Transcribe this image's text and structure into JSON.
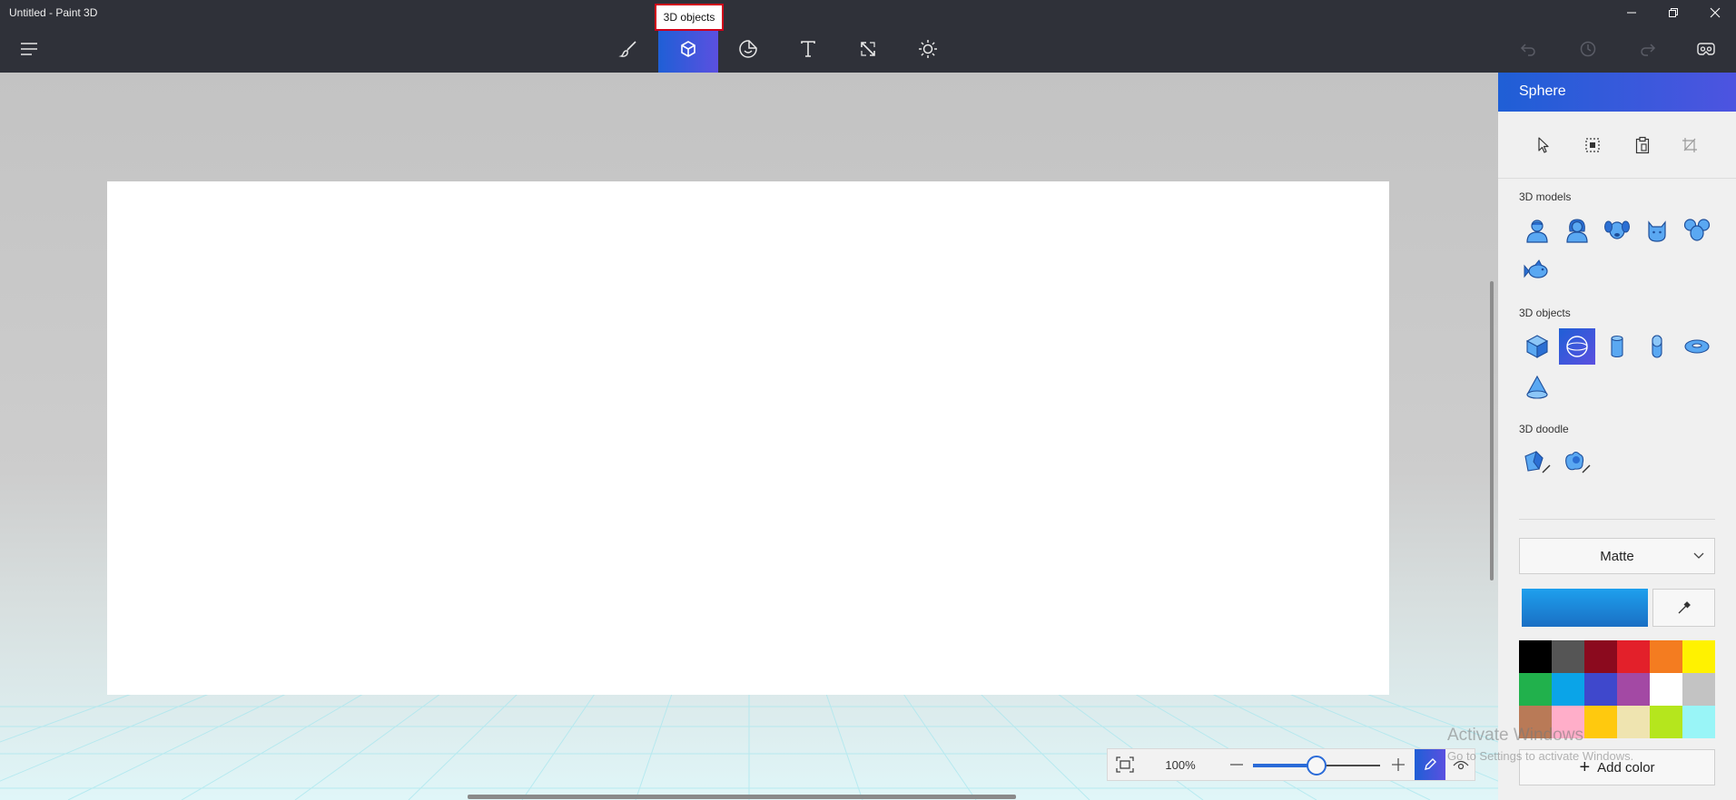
{
  "window": {
    "title": "Untitled - Paint 3D"
  },
  "toolbar": {
    "menu_icon": "hamburger-menu-icon",
    "tools": [
      {
        "name": "Brushes",
        "icon": "brush-icon",
        "active": false
      },
      {
        "name": "3D shapes",
        "icon": "cube-icon",
        "active": true
      },
      {
        "name": "Stickers",
        "icon": "sticker-icon",
        "active": false
      },
      {
        "name": "Text",
        "icon": "text-icon",
        "active": false
      },
      {
        "name": "Canvas",
        "icon": "canvas-resize-icon",
        "active": false
      },
      {
        "name": "Effects",
        "icon": "effects-sun-icon",
        "active": false
      }
    ],
    "tooltip": "3D objects",
    "right": [
      "undo-icon",
      "history-icon",
      "redo-icon",
      "mixed-reality-icon"
    ]
  },
  "zoom": {
    "label": "100%",
    "level_fraction": 0.5
  },
  "panel": {
    "title": "Sphere",
    "sections": {
      "models": "3D models",
      "objects": "3D objects",
      "doodle": "3D doodle"
    },
    "material": "Matte",
    "current_color": "#1a8ae0",
    "palette": [
      "#000000",
      "#555555",
      "#8b0a1e",
      "#e3202a",
      "#f47c20",
      "#fff200",
      "#21b14c",
      "#0aa4e8",
      "#3f48cc",
      "#a349a4",
      "#ffffff",
      "#c3c3c3",
      "#b97a57",
      "#ffaec9",
      "#ffc90e",
      "#efe4b0",
      "#b5e61d",
      "#99f5f7"
    ],
    "add_color": "Add color"
  },
  "watermark": {
    "line1": "Activate Windows",
    "line2": "Go to Settings to activate Windows."
  }
}
